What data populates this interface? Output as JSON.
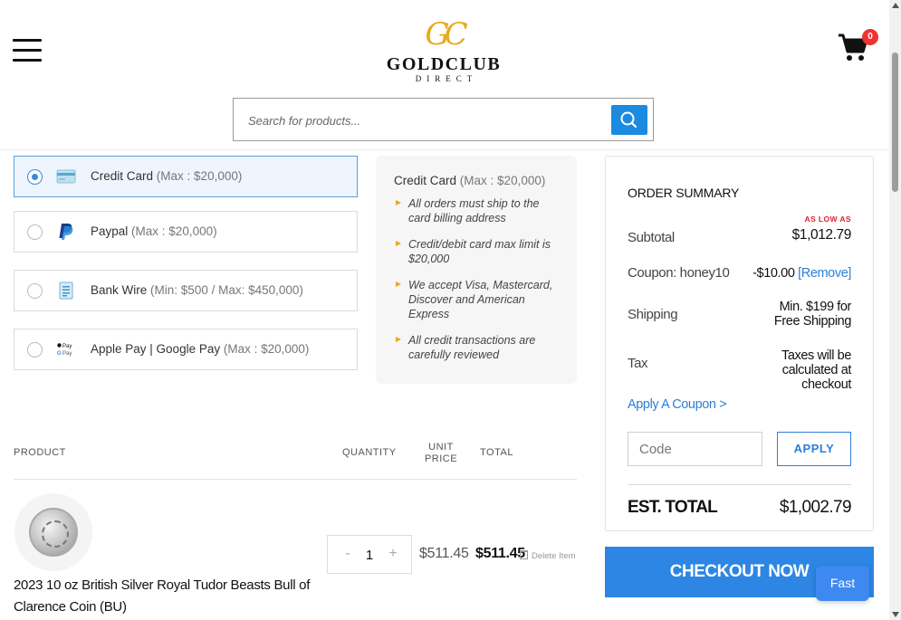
{
  "header": {
    "logo_mark": "GC",
    "logo_name": "GOLDCLUB",
    "logo_sub": "DIRECT",
    "cart_count": "0",
    "search_placeholder": "Search for products..."
  },
  "payment_options": [
    {
      "label": "Credit Card",
      "limit": "(Max : $20,000)",
      "selected": true,
      "icon": "credit-card-icon"
    },
    {
      "label": "Paypal",
      "limit": "(Max : $20,000)",
      "selected": false,
      "icon": "paypal-icon"
    },
    {
      "label": "Bank Wire",
      "limit": "(Min: $500 / Max: $450,000)",
      "selected": false,
      "icon": "bank-document-icon"
    },
    {
      "label": "Apple Pay | Google Pay",
      "limit": "(Max : $20,000)",
      "selected": false,
      "icon": "apple-google-pay-icon"
    }
  ],
  "info": {
    "title": "Credit Card",
    "limit": "(Max : $20,000)",
    "items": [
      "All orders must ship to the card billing address",
      "Credit/debit card max limit is $20,000",
      "We accept Visa, Mastercard, Discover and American Express",
      "All credit transactions are carefully reviewed"
    ]
  },
  "table": {
    "headers": {
      "product": "PRODUCT",
      "quantity": "QUANTITY",
      "unit_price": "UNIT PRICE",
      "total": "TOTAL"
    }
  },
  "product": {
    "name": "2023 10 oz British Silver Royal Tudor Beasts Bull of Clarence Coin (BU)",
    "quantity": "1",
    "qty_minus": "-",
    "qty_plus": "+",
    "unit_price": "$511.45",
    "total_price": "$511.45",
    "delete_label": "Delete Item"
  },
  "summary": {
    "title": "ORDER SUMMARY",
    "low_as": "AS LOW AS",
    "subtotal_label": "Subtotal",
    "subtotal_value": "$1,012.79",
    "coupon_label": "Coupon: honey10",
    "coupon_value": "-$10.00",
    "coupon_remove": "[Remove]",
    "shipping_label": "Shipping",
    "shipping_value": "Min. $199 for Free Shipping",
    "tax_label": "Tax",
    "tax_value": "Taxes will be calculated at checkout",
    "apply_coupon_link": "Apply A Coupon >",
    "code_placeholder": "Code",
    "apply_button": "APPLY",
    "est_total_label": "EST. TOTAL",
    "est_total_value": "$1,002.79"
  },
  "checkout_button": "CHECKOUT NOW",
  "fast_button": "Fast",
  "colors": {
    "accent": "#2d86e3",
    "gold": "#e8a91c",
    "badge": "#e33333"
  }
}
